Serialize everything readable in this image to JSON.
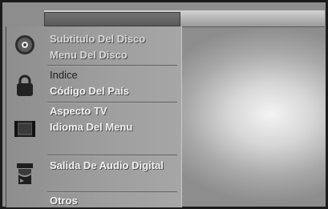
{
  "menu": {
    "groups": [
      {
        "icon": "disc-icon",
        "items": [
          "Subtitulo Del Disco",
          "Menu Del Disco"
        ]
      },
      {
        "icon": "lock-icon",
        "items": [
          "Indice",
          "Código Del País"
        ]
      },
      {
        "icon": "screen-icon",
        "items": [
          "Aspecto TV",
          "Idioma Del Menu"
        ]
      },
      {
        "icon": "audio-output-icon",
        "items": [
          "Salida De Audio Digital"
        ]
      },
      {
        "icon": "",
        "items": [
          "Otros"
        ]
      }
    ]
  }
}
